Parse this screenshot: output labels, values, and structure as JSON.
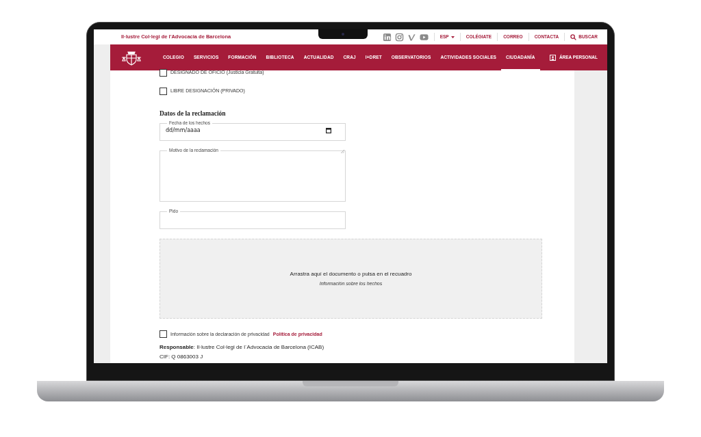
{
  "site_title": "Il·lustre Col·legi de l'Advocacia de Barcelona",
  "top_links": [
    {
      "kind": "language",
      "label": "ESP"
    },
    {
      "kind": "link",
      "label": "COLÉGIATE"
    },
    {
      "kind": "link",
      "label": "CORREO"
    },
    {
      "kind": "link",
      "label": "CONTACTA"
    },
    {
      "kind": "search",
      "label": "BUSCAR"
    }
  ],
  "nav": [
    {
      "label": "COLEGIO",
      "selected": false
    },
    {
      "label": "SERVICIOS",
      "selected": false
    },
    {
      "label": "FORMACIÓN",
      "selected": false
    },
    {
      "label": "BIBLIOTECA",
      "selected": false
    },
    {
      "label": "ACTUALIDAD",
      "selected": false
    },
    {
      "label": "CRAJ",
      "selected": false
    },
    {
      "label": "I+DRET",
      "selected": false
    },
    {
      "label": "OBSERVATORIOS",
      "selected": false
    },
    {
      "label": "ACTIVIDADES SOCIALES",
      "selected": false
    },
    {
      "label": "CIUDADANÍA",
      "selected": true
    }
  ],
  "personal_area": "ÁREA PERSONAL",
  "designation_options": [
    {
      "label": "DESIGNADO DE OFICIO (Justicia Gratuita)",
      "checked": false
    },
    {
      "label": "LIBRE DESIGNACIÓN (PRIVADO)",
      "checked": false
    }
  ],
  "section_heading": "Datos de la reclamación",
  "fields": [
    {
      "kind": "date",
      "label": "Fecha de los hechos",
      "value": "dd/mm/aaaa"
    },
    {
      "kind": "textarea",
      "label": "Motivo de la reclamación"
    },
    {
      "kind": "text",
      "label": "Pido"
    }
  ],
  "dropzone": {
    "text": "Arrastra aquí el documento o pulsa en el recuadro",
    "hint": "Información sobre los hechos"
  },
  "privacy": {
    "checked": false,
    "text": "Información sobre la declaración de privacidad",
    "link": "Política de privacidad"
  },
  "legal_lines": [
    "**Responsable**: Il·lustre Col·legi de l´Advocacia de Barcelona (ICAB)",
    "CIF: Q 0863003 J"
  ]
}
